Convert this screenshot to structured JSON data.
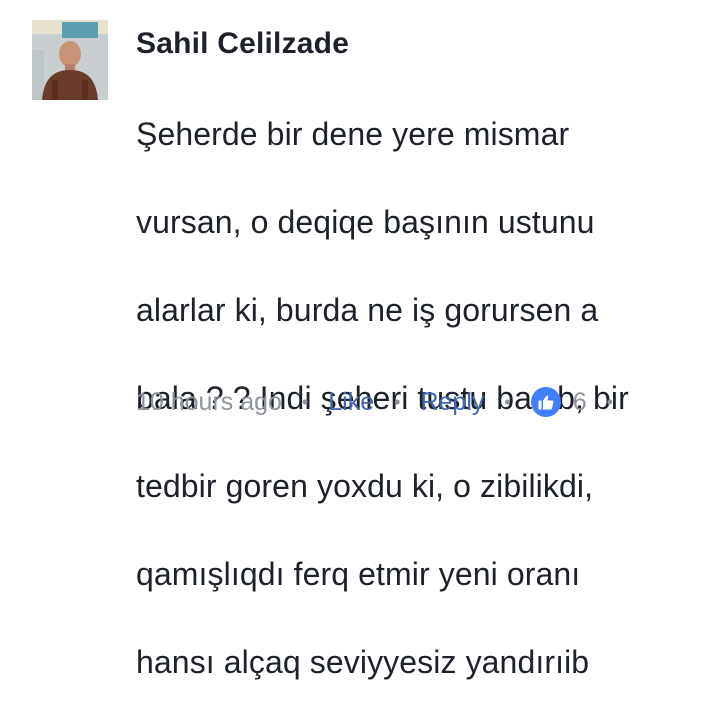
{
  "comment": {
    "author": "Sahil Celilzade",
    "text_lines": [
      "Şeherde bir dene yere mismar",
      "vursan, o deqiqe başının ustunu",
      "alarlar ki, burda ne iş gorursen a",
      "bala ?  ? Indi şeheri tustu basıb, bir",
      "tedbir goren yoxdu ki, o zibilikdi,",
      "qamışlıqdı ferq etmir yeni oranı",
      "hansı alçaq seviyyesiz yandırıib"
    ],
    "timestamp": "10 hours ago",
    "like_label": "Like",
    "reply_label": "Reply",
    "reaction_count": "6",
    "separator": "•",
    "reaction_icon": "thumbs-up-icon"
  },
  "colors": {
    "text": "#1d2129",
    "muted": "#90949c",
    "link": "#4267b2",
    "reaction": "#4080ff"
  }
}
